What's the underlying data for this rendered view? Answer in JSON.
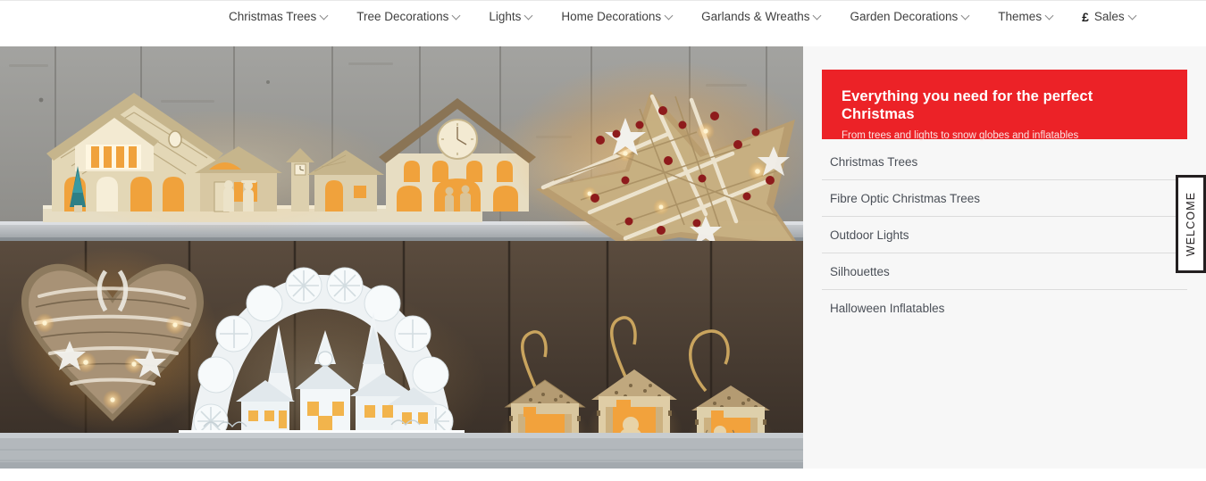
{
  "nav": {
    "items": [
      {
        "label": "Christmas Trees",
        "icon": "chevron-down-icon",
        "prefix": ""
      },
      {
        "label": "Tree Decorations",
        "icon": "chevron-down-icon",
        "prefix": ""
      },
      {
        "label": "Lights",
        "icon": "chevron-down-icon",
        "prefix": ""
      },
      {
        "label": "Home Decorations",
        "icon": "chevron-down-icon",
        "prefix": ""
      },
      {
        "label": "Garlands & Wreaths",
        "icon": "chevron-down-icon",
        "prefix": ""
      },
      {
        "label": "Garden Decorations",
        "icon": "chevron-down-icon",
        "prefix": ""
      },
      {
        "label": "Themes",
        "icon": "chevron-down-icon",
        "prefix": ""
      },
      {
        "label": "Sales",
        "icon": "chevron-down-icon",
        "prefix": "£"
      }
    ]
  },
  "hero": {
    "alt": "Lit wooden Christmas village houses, twig star, snowflake arch and house lanterns on grey wooden shelves",
    "colors": {
      "wall_top": "#9a9a98",
      "wall_bottom": "#4a3f35",
      "shelf": "#b9bcc0",
      "glow": "#f2a23c",
      "wood_light": "#ddcfab"
    }
  },
  "promo": {
    "title": "Everything you need for the perfect Christmas",
    "subtitle": "From trees and lights to snow globes and inflatables",
    "background": "#ec2227"
  },
  "sidebar": {
    "links": [
      {
        "label": "Christmas Trees"
      },
      {
        "label": "Fibre Optic Christmas Trees"
      },
      {
        "label": "Outdoor Lights"
      },
      {
        "label": "Silhouettes"
      },
      {
        "label": "Halloween Inflatables"
      }
    ]
  },
  "welcome_tab": {
    "label": "WELCOME"
  }
}
